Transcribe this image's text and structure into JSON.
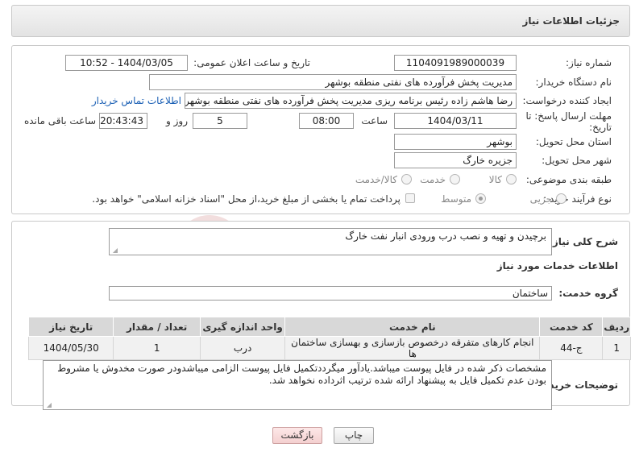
{
  "header": {
    "title": "جزئیات اطلاعات نیاز"
  },
  "form": {
    "need_number_label": "شماره نیاز:",
    "need_number": "1104091989000039",
    "announce_label": "تاریخ و ساعت اعلان عمومی:",
    "announce_value": "1404/03/05 - 10:52",
    "buyer_org_label": "نام دستگاه خریدار:",
    "buyer_org": "مدیریت پخش فرآورده های نفتی منطقه بوشهر",
    "requester_label": "ایجاد کننده درخواست:",
    "requester": "رضا هاشم زاده رئیس برنامه ریزی مدیریت پخش فرآورده های نفتی منطقه بوشهر",
    "contact_link": "اطلاعات تماس خریدار",
    "deadline_label": "مهلت ارسال پاسخ: تا تاریخ:",
    "deadline_date": "1404/03/11",
    "time_label": "ساعت",
    "deadline_time": "08:00",
    "days_value": "5",
    "days_label": "روز و",
    "remaining_time": "20:43:43",
    "remaining_label": "ساعت باقی مانده",
    "province_label": "استان محل تحویل:",
    "province": "بوشهر",
    "city_label": "شهر محل تحویل:",
    "city": "جزیره خارگ",
    "category_label": "طبقه بندی موضوعی:",
    "category_options": [
      "کالا",
      "خدمت",
      "کالا/خدمت"
    ],
    "purchase_type_label": "نوع فرآیند خرید :",
    "purchase_options": [
      "جزیی",
      "متوسط"
    ],
    "payment_note": "پرداخت تمام یا بخشی از مبلغ خرید،از محل \"اسناد خزانه اسلامی\" خواهد بود."
  },
  "summary": {
    "label": "شرح کلی نیاز:",
    "text": "برچیدن و تهیه و نصب درب ورودی انبار نفت خارگ"
  },
  "services": {
    "section_title": "اطلاعات خدمات مورد نیاز",
    "group_label": "گروه خدمت:",
    "group_value": "ساختمان",
    "columns": [
      "ردیف",
      "کد خدمت",
      "نام خدمت",
      "واحد اندازه گیری",
      "تعداد / مقدار",
      "تاریخ نیاز"
    ],
    "rows": [
      {
        "row": "1",
        "code": "ج-44",
        "name": "انجام کارهای متفرقه درخصوص بازسازی و بهسازی ساختمان ها",
        "unit": "درب",
        "qty": "1",
        "date": "1404/05/30"
      }
    ]
  },
  "buyer_notes": {
    "label": "توضیحات خریدار:",
    "text": "مشخصات ذکر شده در فایل پیوست میباشد.یادآور میگرددتکمیل فایل پیوست الزامی میباشدودر صورت مخدوش یا مشروط بودن عدم تکمیل فایل به پیشنهاد ارائه شده ترتیب اثرداده نخواهد شد."
  },
  "actions": {
    "print": "چاپ",
    "back": "بازگشت"
  },
  "watermark": {
    "text": "AriaTender.neT"
  }
}
